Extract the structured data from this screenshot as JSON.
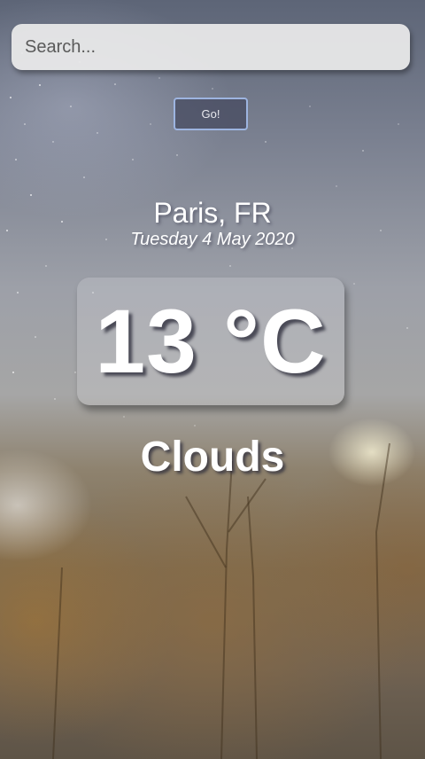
{
  "search": {
    "placeholder": "Search...",
    "value": ""
  },
  "go_button": {
    "label": "Go!"
  },
  "weather": {
    "location": "Paris, FR",
    "date": "Tuesday 4 May 2020",
    "temperature": "13 °C",
    "condition": "Clouds"
  }
}
